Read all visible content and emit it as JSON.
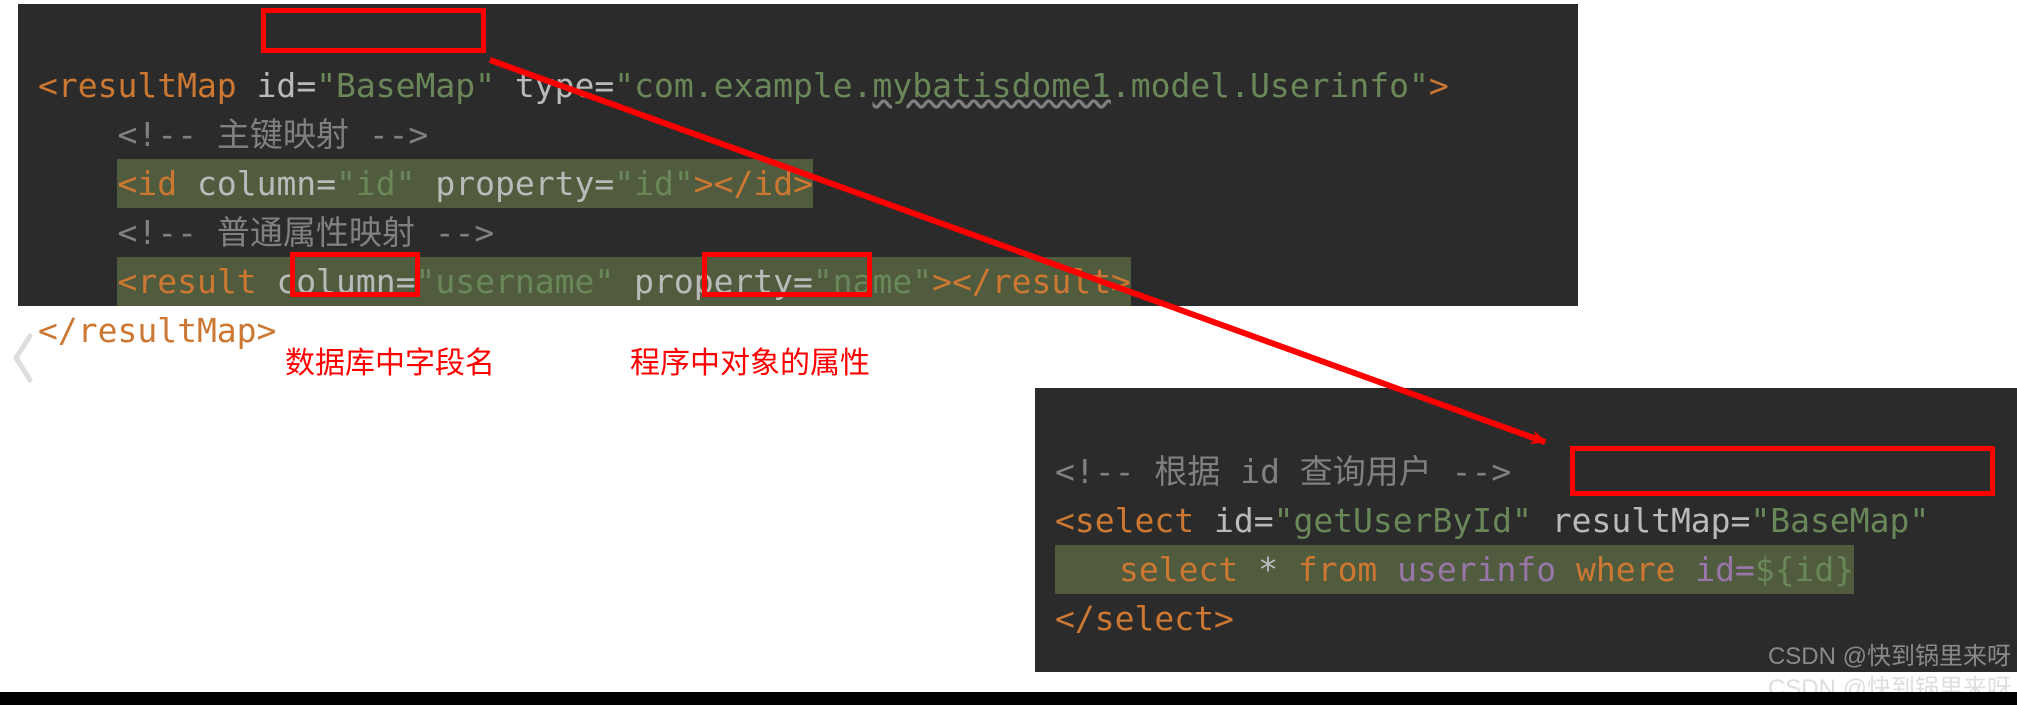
{
  "top": {
    "line1_open": "<resultMap",
    "line1_attr_id": "id",
    "line1_val_id": "\"BaseMap\"",
    "line1_attr_type": "type",
    "line1_val_type": "\"com.example.mybatisdome1.model.Userinfo\"",
    "line1_close": ">",
    "comment1": "<!-- 主键映射 -->",
    "line3_open": "<id",
    "line3_attr_col": "column",
    "line3_val_col": "\"id\"",
    "line3_attr_prop": "property",
    "line3_val_prop": "\"id\"",
    "line3_close": "></id>",
    "comment2": "<!-- 普通属性映射 -->",
    "line5_open": "<result",
    "line5_attr_col": "column",
    "line5_val_col": "\"username\"",
    "line5_attr_prop": "property",
    "line5_val_prop": "\"name\"",
    "line5_close": "></result>",
    "line6": "</resultMap>"
  },
  "bot": {
    "comment": "<!-- 根据 id 查询用户 -->",
    "sel_open": "<select",
    "sel_attr_id": "id",
    "sel_val_id": "\"getUserById\"",
    "sel_attr_rm": "resultMap",
    "sel_val_rm": "\"BaseMap\"",
    "sql_select": "select",
    "sql_star": " * ",
    "sql_from": "from",
    "sql_table": " userinfo ",
    "sql_where": "where",
    "sql_idc": " id=",
    "sql_expr": "${id}",
    "sel_close": "</select>"
  },
  "labels": {
    "column": "数据库中字段名",
    "property": "程序中对象的属性"
  },
  "watermarks": {
    "wm1": "CSDN @快到锅里来呀",
    "wm2": "CSDN @快到锅里来呀"
  }
}
